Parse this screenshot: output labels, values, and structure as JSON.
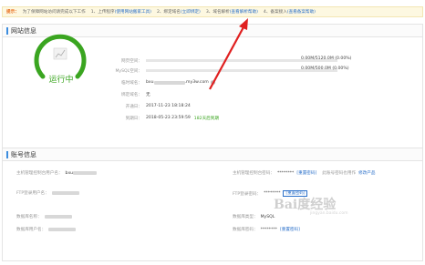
{
  "tip": {
    "label": "提示：",
    "text": "为了保障网站访问请完成以下工作",
    "step1": "1、上传程序",
    "step1_link": "(使用网站搬家工具)",
    "step2": "2、绑定域名",
    "step2_link": "(立即绑定)",
    "step3": "3、域名解析",
    "step3_link": "(查看解析帮助)",
    "step4": "4、备案接入",
    "step4_link": "(查看备案帮助)"
  },
  "site": {
    "title": "网站信息",
    "status": "运行中",
    "web_space_label": "网页空间：",
    "web_space_value": "0.00M/5120.0M (0.00%)",
    "web_space_usage": 0,
    "mysql_label": "MySQL空间：",
    "mysql_value": "0.00M/500.0M (0.00%)",
    "mysql_usage": 0,
    "temp_domain_label": "临时域名：",
    "temp_domain_prefix": "bxu",
    "temp_domain_suffix": ".my3w.com",
    "bound_domain_label": "绑定域名：",
    "bound_domain_value": "无",
    "open_date_label": "开通日：",
    "open_date_value": "2017-11-23 18:18:24",
    "expire_label": "到期日：",
    "expire_value": "2018-05-23 23:59:59",
    "expire_days": "182天后到期"
  },
  "account": {
    "title": "账号信息",
    "host_user_label": "主机管理控制台用户名：",
    "host_user_value": "bxu",
    "host_pwd_label": "主机管理控制台密码：",
    "host_pwd_value": "********",
    "host_pwd_reset": "[重置密码]",
    "host_pwd_note": "此账号密码也用作",
    "host_pwd_note_link": "修改产品",
    "ftp_user_label": "FTP登录用户名：",
    "ftp_pwd_label": "FTP登录密码：",
    "ftp_pwd_value": "********",
    "ftp_pwd_reset": "[重置密码]",
    "db_name_label": "数据库名称：",
    "db_type_label": "数据库类型：",
    "db_type_value": "MySQL",
    "db_user_label": "数据库用户名：",
    "db_pwd_label": "数据库密码：",
    "db_pwd_value": "********",
    "db_pwd_reset": "[重置密码]"
  },
  "watermark": {
    "text": "Bai度经验",
    "sub": "jingyan.baidu.com"
  },
  "colors": {
    "running_green": "#3aa520",
    "link_blue": "#2a6fc9",
    "tip_orange": "#e86c1a",
    "arrow_red": "#e02020"
  }
}
